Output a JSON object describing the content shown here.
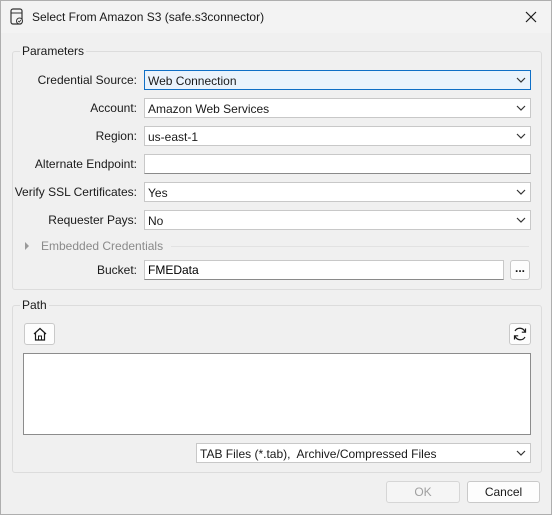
{
  "window": {
    "title": "Select From Amazon S3 (safe.s3connector)"
  },
  "parameters": {
    "group_title": "Parameters",
    "credential_source": {
      "label": "Credential Source:",
      "value": "Web Connection"
    },
    "account": {
      "label": "Account:",
      "value": "Amazon Web Services"
    },
    "region": {
      "label": "Region:",
      "value": "us-east-1"
    },
    "alternate_endpoint": {
      "label": "Alternate Endpoint:",
      "value": ""
    },
    "verify_ssl": {
      "label": "Verify SSL Certificates:",
      "value": "Yes"
    },
    "requester_pays": {
      "label": "Requester Pays:",
      "value": "No"
    },
    "embedded_credentials": {
      "label": "Embedded Credentials",
      "expanded": false
    },
    "bucket": {
      "label": "Bucket:",
      "value": "FMEData",
      "browse_label": "..."
    }
  },
  "path": {
    "group_title": "Path",
    "filter": "TAB Files (*.tab),  Archive/Compressed Files"
  },
  "footer": {
    "ok_label": "OK",
    "cancel_label": "Cancel"
  }
}
